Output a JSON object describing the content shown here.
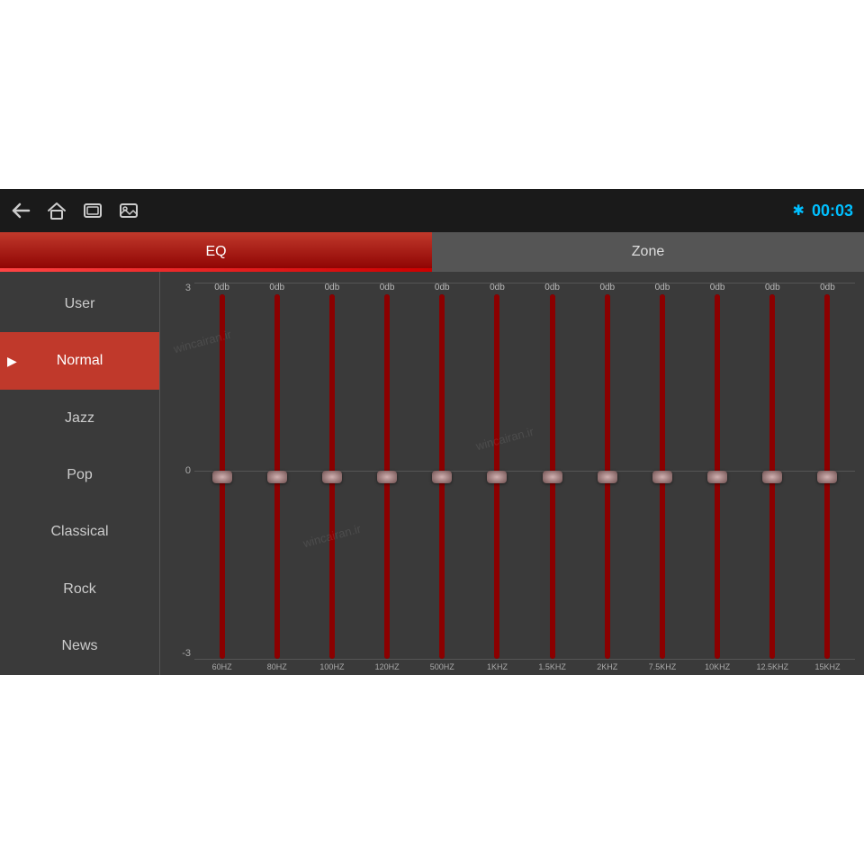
{
  "topbar": {
    "clock": "00:03",
    "back_icon": "←",
    "home_icon": "⌂",
    "window_icon": "▢",
    "image_icon": "🖼",
    "bluetooth_icon": "✱"
  },
  "tabs": [
    {
      "label": "EQ",
      "active": true
    },
    {
      "label": "Zone",
      "active": false
    }
  ],
  "sidebar": {
    "items": [
      {
        "label": "User",
        "active": false
      },
      {
        "label": "Normal",
        "active": true
      },
      {
        "label": "Jazz",
        "active": false
      },
      {
        "label": "Pop",
        "active": false
      },
      {
        "label": "Classical",
        "active": false
      },
      {
        "label": "Rock",
        "active": false
      },
      {
        "label": "News",
        "active": false
      }
    ]
  },
  "eq": {
    "scale": {
      "top": "3",
      "mid": "0",
      "bot": "-3"
    },
    "bands": [
      {
        "hz": "60HZ",
        "db": "0db",
        "value": 0
      },
      {
        "hz": "80HZ",
        "db": "0db",
        "value": 0
      },
      {
        "hz": "100HZ",
        "db": "0db",
        "value": 0
      },
      {
        "hz": "120HZ",
        "db": "0db",
        "value": 0
      },
      {
        "hz": "500HZ",
        "db": "0db",
        "value": 0
      },
      {
        "hz": "1KHZ",
        "db": "0db",
        "value": 0
      },
      {
        "hz": "1.5KHZ",
        "db": "0db",
        "value": 0
      },
      {
        "hz": "2KHZ",
        "db": "0db",
        "value": 0
      },
      {
        "hz": "7.5KHZ",
        "db": "0db",
        "value": 0
      },
      {
        "hz": "10KHZ",
        "db": "0db",
        "value": 0
      },
      {
        "hz": "12.5KHZ",
        "db": "0db",
        "value": 0
      },
      {
        "hz": "15KHZ",
        "db": "0db",
        "value": 0
      }
    ]
  },
  "colors": {
    "accent_red": "#c0392b",
    "accent_blue": "#00bfff",
    "bg_dark": "#2a2a2a",
    "bg_sidebar": "#3a3a3a",
    "slider_active": "#8b0000"
  }
}
